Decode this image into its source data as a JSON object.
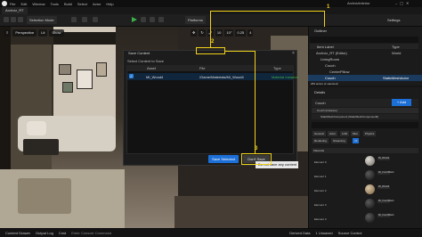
{
  "menubar": {
    "items": [
      "File",
      "Edit",
      "Window",
      "Tools",
      "Build",
      "Select",
      "Actor",
      "Help"
    ],
    "project_title": "ArchvizInterior"
  },
  "tabs": {
    "level_tab": "Archviz_RT"
  },
  "toolbar": {
    "mode": "Selection Mode",
    "platforms": "Platforms",
    "settings": "Settings"
  },
  "viewport": {
    "perspective": "Perspective",
    "lit": "Lit",
    "show": "Show",
    "grid_snap": "10",
    "rot_snap": "10°",
    "scale_snap": "0.25",
    "camera_speed": "4"
  },
  "dialog": {
    "title": "Save Content",
    "subtitle": "Select Content to Save",
    "columns": [
      "Asset",
      "File",
      "Type"
    ],
    "rows": [
      {
        "asset": "MI_Wood4",
        "file": "/Game/Materials/MI_Wood4",
        "type": "Material Instance"
      }
    ],
    "save_selected": "Save Selected",
    "dont_save": "Don't Save",
    "tooltip": "Do not save any content"
  },
  "annotations": {
    "step1": "1",
    "step2": "2",
    "step3": "3"
  },
  "outliner": {
    "title": "Outliner",
    "col_label": "Item Label",
    "col_type": "Type",
    "items": [
      "Archviz_RT (Editor)",
      "LivingRoom",
      "Couch",
      "CenterPillow",
      "Couch"
    ],
    "type_world": "World",
    "type_selected": "StaticMeshActor",
    "status": "283 actors (1 selected)"
  },
  "details": {
    "title": "Details",
    "actor": "Couch",
    "add": "+ Add",
    "instance": "Couch (Instance)",
    "component": "StaticMeshComponent (StaticMeshComponent0)",
    "filter_tabs": [
      "General",
      "Actor",
      "LOD",
      "Misc",
      "Physics"
    ],
    "filter_tabs2": [
      "Rendering",
      "Streaming",
      "All"
    ],
    "materials_label": "Materials",
    "elements": [
      "Element 0",
      "Element 1",
      "Element 2",
      "Element 3",
      "Element 4"
    ],
    "materials": [
      "MI_Wood4",
      "MI_CouchBlack",
      "MI_Wood4",
      "MI_CouchBlack",
      "MI_CouchBlack"
    ]
  },
  "statusbar": {
    "items": [
      "Content Drawer",
      "Output Log",
      "Cmd",
      "Enter Console Command"
    ],
    "derived": "Derived Data",
    "unsaved": "1 Unsaved",
    "source": "Source Control"
  },
  "colors": {
    "accent": "#1c6fd6",
    "annotation": "#f2d21b",
    "play": "#3cb14a"
  }
}
